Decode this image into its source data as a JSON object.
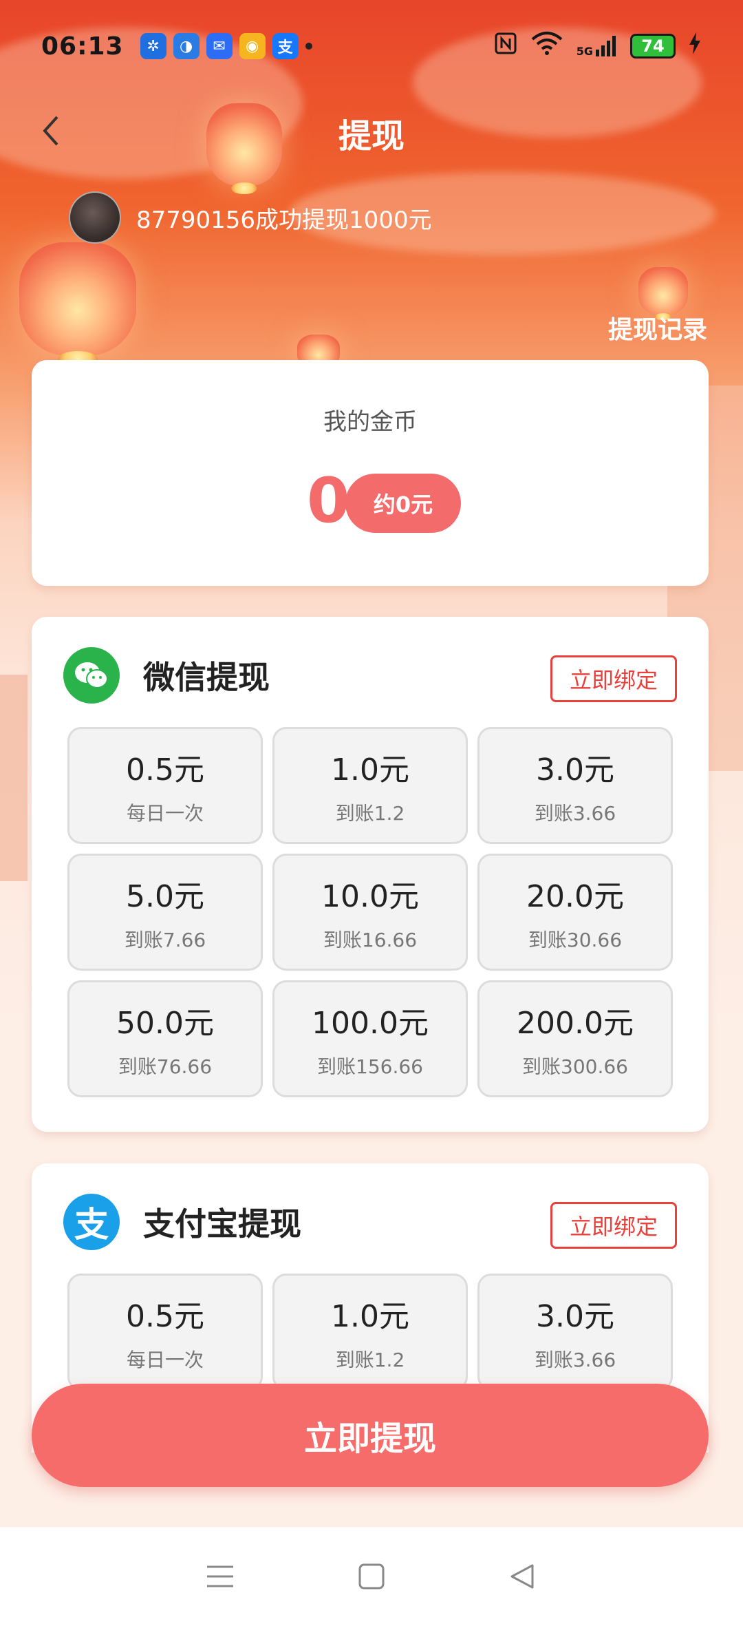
{
  "status_bar": {
    "time": "06:13",
    "apps": [
      {
        "icon": "pinwheel-app-icon",
        "color": "#1f6fe0",
        "glyph": "✲"
      },
      {
        "icon": "browser-app-icon",
        "color": "#2a7be4",
        "glyph": "◑"
      },
      {
        "icon": "message-app-icon",
        "color": "#2d6df5",
        "glyph": "✉"
      },
      {
        "icon": "weibo-app-icon",
        "color": "#f6b51e",
        "glyph": "◉"
      },
      {
        "icon": "alipay-app-icon",
        "color": "#1677ff",
        "glyph": "支"
      }
    ],
    "signal_label": "5G",
    "battery": "74"
  },
  "header": {
    "title": "提现",
    "notice": "87790156成功提现1000元",
    "record_link": "提现记录"
  },
  "coins": {
    "label": "我的金币",
    "value": "0",
    "equivalent": "约0元"
  },
  "wechat": {
    "title": "微信提现",
    "bind_label": "立即绑定",
    "brand_color": "#2ab34a",
    "options": [
      {
        "amount": "0.5元",
        "sub": "每日一次"
      },
      {
        "amount": "1.0元",
        "sub": "到账1.2"
      },
      {
        "amount": "3.0元",
        "sub": "到账3.66"
      },
      {
        "amount": "5.0元",
        "sub": "到账7.66"
      },
      {
        "amount": "10.0元",
        "sub": "到账16.66"
      },
      {
        "amount": "20.0元",
        "sub": "到账30.66"
      },
      {
        "amount": "50.0元",
        "sub": "到账76.66"
      },
      {
        "amount": "100.0元",
        "sub": "到账156.66"
      },
      {
        "amount": "200.0元",
        "sub": "到账300.66"
      }
    ]
  },
  "alipay": {
    "title": "支付宝提现",
    "bind_label": "立即绑定",
    "brand_color": "#1aa0e8",
    "icon_glyph": "支",
    "options": [
      {
        "amount": "0.5元",
        "sub": "每日一次"
      },
      {
        "amount": "1.0元",
        "sub": "到账1.2"
      },
      {
        "amount": "3.0元",
        "sub": "到账3.66"
      }
    ]
  },
  "action": {
    "withdraw_label": "立即提现"
  },
  "colors": {
    "accent": "#f66c6a",
    "bind_red": "#e8403a"
  }
}
